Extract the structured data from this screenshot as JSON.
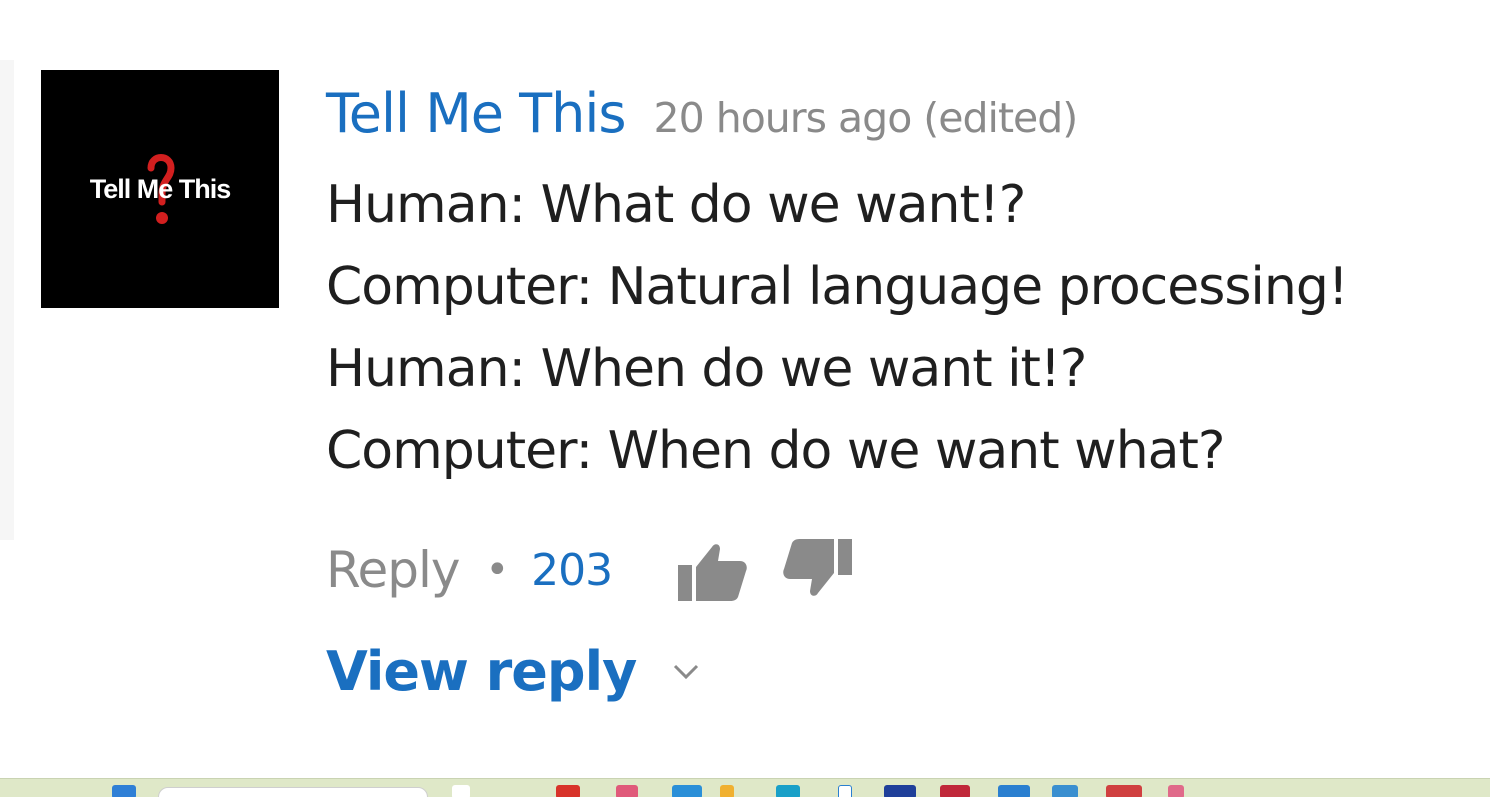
{
  "comment": {
    "avatar_text": "Tell Me This",
    "author": "Tell Me This",
    "timestamp": "20 hours ago (edited)",
    "lines": [
      "Human: What do we want!?",
      "Computer: Natural language processing!",
      "Human: When do we want it!?",
      "Computer: When do we want what?"
    ],
    "reply_label": "Reply",
    "separator": "•",
    "like_count": "203",
    "view_reply_label": "View reply"
  },
  "icons": {
    "like": "thumbs-up-icon",
    "dislike": "thumbs-down-icon",
    "expand": "chevron-down-icon"
  },
  "colors": {
    "link": "#1a6fc0",
    "muted": "#8a8a8a",
    "text": "#1f1f1f",
    "avatar_bg": "#000000",
    "avatar_mark": "#d21f1f",
    "taskbar": "#dfe8c8"
  }
}
